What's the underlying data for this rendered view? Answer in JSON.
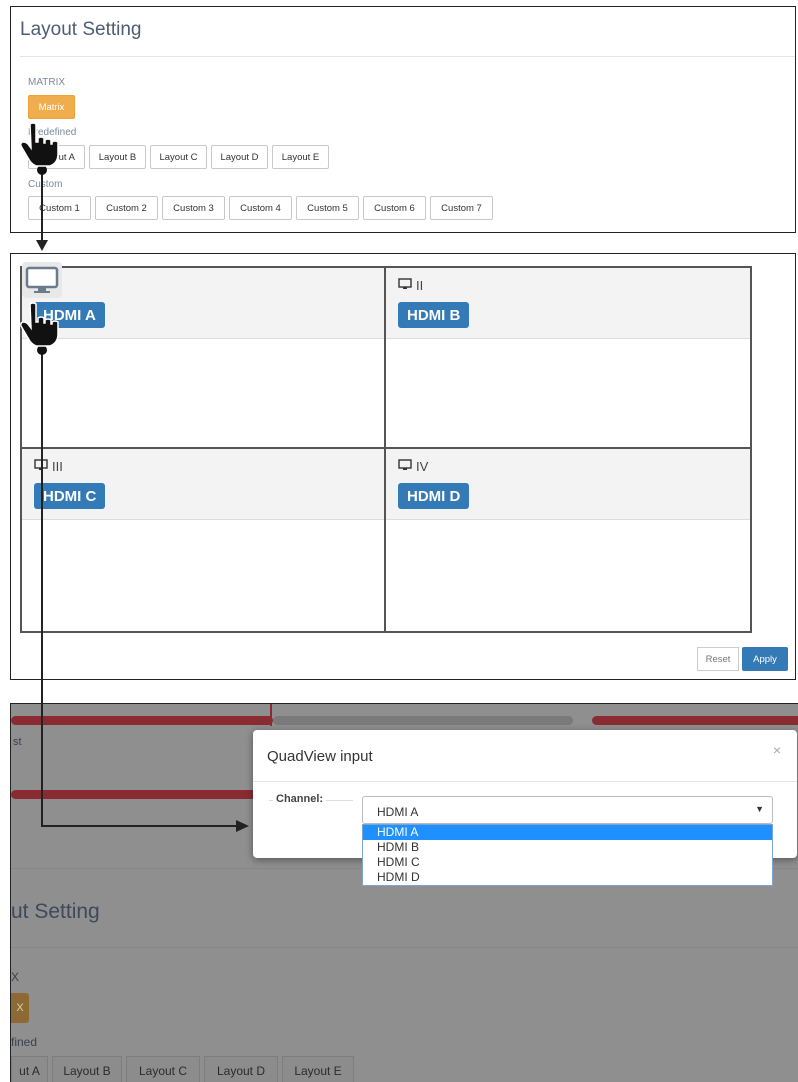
{
  "layout_setting": {
    "title": "Layout Setting",
    "matrix_label": "MATRIX",
    "matrix_button": "Matrix",
    "predefined_label": "Predefined",
    "predefined_buttons": [
      "Layout A",
      "Layout B",
      "Layout C",
      "Layout D",
      "Layout E"
    ],
    "custom_label": "Custom",
    "custom_buttons": [
      "Custom 1",
      "Custom 2",
      "Custom 3",
      "Custom 4",
      "Custom 5",
      "Custom 6",
      "Custom 7"
    ]
  },
  "quadview": {
    "quadrants": [
      {
        "number": "I",
        "input": "HDMI A"
      },
      {
        "number": "II",
        "input": "HDMI B"
      },
      {
        "number": "III",
        "input": "HDMI C"
      },
      {
        "number": "IV",
        "input": "HDMI D"
      }
    ],
    "reset_label": "Reset",
    "apply_label": "Apply"
  },
  "background": {
    "fragment_text": "st",
    "title_partial": "ut Setting",
    "matrix_partial": "X",
    "matrix_button_partial": "X",
    "predefined_partial": "fined",
    "layout_buttons": [
      "ut A",
      "Layout B",
      "Layout C",
      "Layout D",
      "Layout E"
    ]
  },
  "modal": {
    "title": "QuadView input",
    "close_symbol": "×",
    "channel_label": "Channel:",
    "selected_value": "HDMI A",
    "options": [
      "HDMI A",
      "HDMI B",
      "HDMI C",
      "HDMI D"
    ],
    "highlighted_option": "HDMI A"
  },
  "colors": {
    "accent_blue": "#337ab7",
    "matrix_orange": "#f0ad4e",
    "highlight_blue": "#1e90ff",
    "red_bar": "#8a2b33"
  },
  "icons": {
    "cursor": "pointing-hand-icon",
    "monitor": "monitor-icon"
  }
}
